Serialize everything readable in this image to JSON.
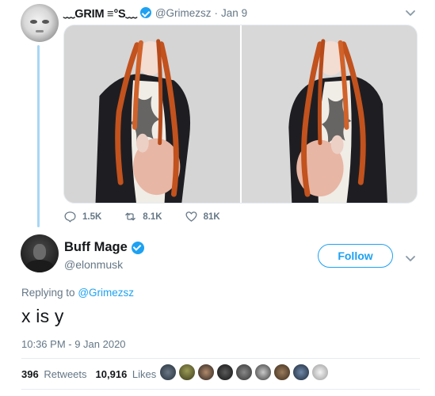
{
  "parent_tweet": {
    "display_name": "﹏GRIM ≡°S﹏",
    "handle": "@Grimezsz",
    "separator": "·",
    "date": "Jan 9",
    "actions": {
      "replies": "1.5K",
      "retweets": "8.1K",
      "likes": "81K"
    }
  },
  "tweet": {
    "display_name": "Buff Mage",
    "handle": "@elonmusk",
    "follow_label": "Follow",
    "replying_prefix": "Replying to",
    "replying_to": "@Grimezsz",
    "text": "x is y",
    "timestamp": "10:36 PM - 9 Jan 2020",
    "retweets_count": "396",
    "retweets_label": "Retweets",
    "likes_count": "10,916",
    "likes_label": "Likes"
  },
  "colors": {
    "accent": "#1da1f2",
    "secondary_text": "#657786",
    "thread_line": "#a8d6f5"
  },
  "icons": [
    "chevron-down-icon",
    "reply-icon",
    "retweet-icon",
    "like-icon",
    "verified-badge-icon"
  ]
}
